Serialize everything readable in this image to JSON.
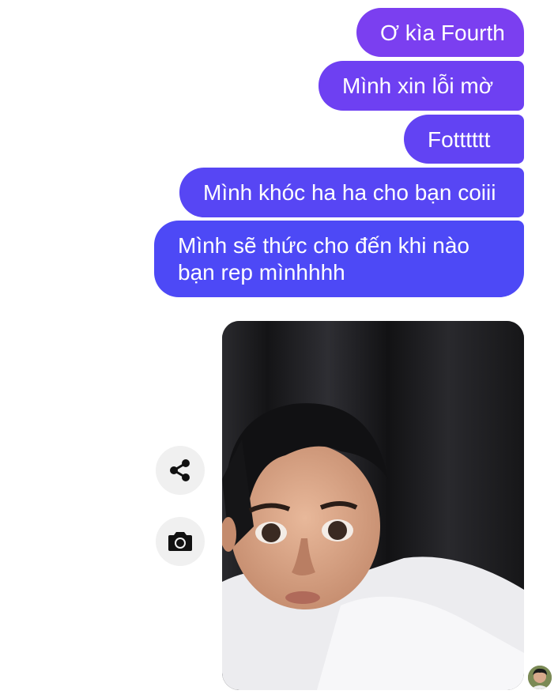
{
  "messages": [
    {
      "text": "Ơ kìa Fourth"
    },
    {
      "text": "Mình xin lỗi mờ"
    },
    {
      "text": "Fotttttt"
    },
    {
      "text": "Mình khóc ha ha cho bạn coiii"
    },
    {
      "text": "Mình sẽ thức cho đến khi nào bạn rep mìnhhhh"
    }
  ],
  "attachment": {
    "type": "photo"
  },
  "actions": {
    "share_icon": "share-icon",
    "camera_icon": "camera-icon"
  },
  "colors": {
    "bubble_top": "#7b3ff0",
    "bubble_bottom": "#4d49f6",
    "action_bg": "#f0f0f0"
  }
}
